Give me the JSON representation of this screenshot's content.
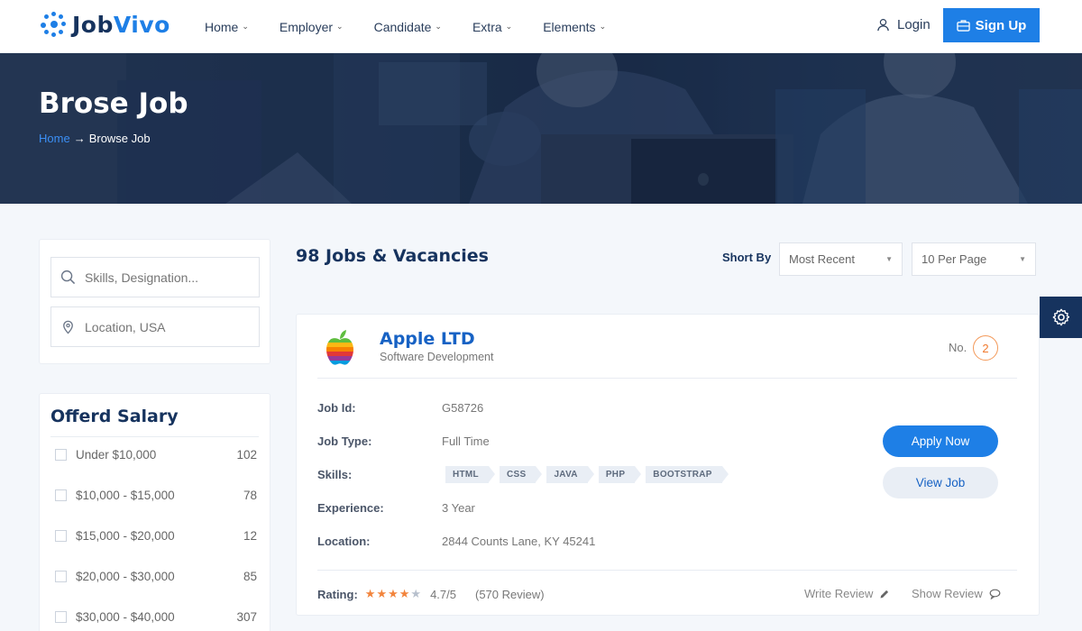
{
  "header": {
    "logo_prefix": "Job",
    "logo_suffix": "Vivo",
    "nav": [
      {
        "label": "Home"
      },
      {
        "label": "Employer"
      },
      {
        "label": "Candidate"
      },
      {
        "label": "Extra"
      },
      {
        "label": "Elements"
      }
    ],
    "login_label": "Login",
    "signup_label": "Sign Up",
    "accent_color": "#1e7fe6",
    "brand_color": "#16335e"
  },
  "hero": {
    "title": "Brose Job",
    "breadcrumb_home": "Home",
    "breadcrumb_current": "Browse Job"
  },
  "sidebar": {
    "skills_placeholder": "Skills, Designation...",
    "location_placeholder": "Location, USA",
    "salary_title": "Offerd Salary",
    "salary_ranges": [
      {
        "label": "Under $10,000",
        "count": "102"
      },
      {
        "label": "$10,000 - $15,000",
        "count": "78"
      },
      {
        "label": "$15,000 - $20,000",
        "count": "12"
      },
      {
        "label": "$20,000 - $30,000",
        "count": "85"
      },
      {
        "label": "$30,000 - $40,000",
        "count": "307"
      }
    ]
  },
  "main": {
    "jobs_count": "98 Jobs & Vacancies",
    "sort_label": "Short By",
    "sort_value": "Most Recent",
    "per_page_value": "10 Per Page"
  },
  "job": {
    "company": "Apple LTD",
    "category": "Software Development",
    "no_label": "No.",
    "no_value": "2",
    "labels": {
      "id": "Job Id:",
      "type": "Job Type:",
      "skills": "Skills:",
      "experience": "Experience:",
      "location": "Location:",
      "rating": "Rating:"
    },
    "id": "G58726",
    "type": "Full Time",
    "skills": [
      "HTML",
      "CSS",
      "JAVA",
      "PHP",
      "BOOTSTRAP"
    ],
    "experience": "3 Year",
    "location": "2844 Counts Lane, KY 45241",
    "apply_label": "Apply Now",
    "view_label": "View Job",
    "rating_stars": 4,
    "rating_value": "4.7/5",
    "review_count": "(570 Review)",
    "write_review": "Write Review",
    "show_review": "Show Review"
  }
}
